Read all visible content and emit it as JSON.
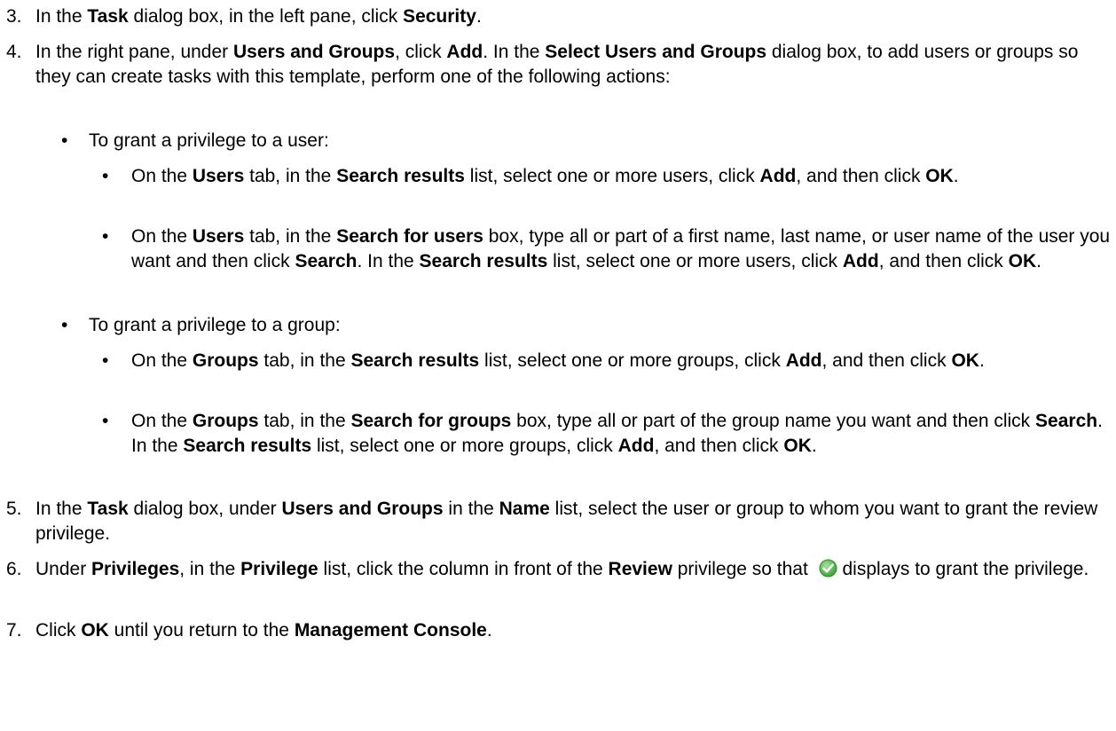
{
  "steps": [
    {
      "num": "3.",
      "parts": [
        {
          "t": "In the "
        },
        {
          "b": "Task"
        },
        {
          "t": " dialog box, in the left pane, click "
        },
        {
          "b": "Security"
        },
        {
          "t": "."
        }
      ]
    },
    {
      "num": "4.",
      "parts": [
        {
          "t": "In the right pane, under "
        },
        {
          "b": "Users and Groups"
        },
        {
          "t": ", click "
        },
        {
          "b": "Add"
        },
        {
          "t": ". In the "
        },
        {
          "b": "Select Users and Groups"
        },
        {
          "t": " dialog box, to add users or groups so they can create tasks with this template, perform one of the following actions:"
        }
      ]
    },
    {
      "num": "5.",
      "parts": [
        {
          "t": "In the "
        },
        {
          "b": "Task"
        },
        {
          "t": " dialog box, under "
        },
        {
          "b": "Users and Groups"
        },
        {
          "t": " in the "
        },
        {
          "b": "Name"
        },
        {
          "t": " list, select the user or group to whom you want to grant the review privilege."
        }
      ]
    },
    {
      "num": "6.",
      "parts": [
        {
          "t": "Under "
        },
        {
          "b": "Privileges"
        },
        {
          "t": ", in the "
        },
        {
          "b": "Privilege"
        },
        {
          "t": " list, click the column in front of the "
        },
        {
          "b": "Review"
        },
        {
          "t": " privilege so that "
        },
        {
          "icon": "checkmark-icon"
        },
        {
          "t": " displays to grant the privilege."
        }
      ]
    },
    {
      "num": "7.",
      "parts": [
        {
          "t": "Click "
        },
        {
          "b": "OK"
        },
        {
          "t": " until you return to the "
        },
        {
          "b": "Management Console"
        },
        {
          "t": "."
        }
      ]
    }
  ],
  "bullets_level1": [
    "To grant a privilege to a user:",
    "To grant a privilege to a group:"
  ],
  "bullets_level2": [
    [
      {
        "t": "On the "
      },
      {
        "b": "Users"
      },
      {
        "t": " tab, in the "
      },
      {
        "b": "Search results"
      },
      {
        "t": " list, select one or more users, click "
      },
      {
        "b": "Add"
      },
      {
        "t": ", and then click "
      },
      {
        "b": "OK"
      },
      {
        "t": "."
      }
    ],
    [
      {
        "t": "On the "
      },
      {
        "b": "Users"
      },
      {
        "t": " tab, in the "
      },
      {
        "b": "Search for users"
      },
      {
        "t": " box, type all or part of a first name, last name, or user name of the user you want and then click "
      },
      {
        "b": "Search"
      },
      {
        "t": ". In the "
      },
      {
        "b": "Search results"
      },
      {
        "t": " list, select one or more users, click "
      },
      {
        "b": "Add"
      },
      {
        "t": ", and then click "
      },
      {
        "b": "OK"
      },
      {
        "t": "."
      }
    ],
    [
      {
        "t": "On the "
      },
      {
        "b": "Groups"
      },
      {
        "t": " tab, in the "
      },
      {
        "b": "Search results"
      },
      {
        "t": " list, select one or more groups, click "
      },
      {
        "b": "Add"
      },
      {
        "t": ", and then click "
      },
      {
        "b": "OK"
      },
      {
        "t": "."
      }
    ],
    [
      {
        "t": "On the "
      },
      {
        "b": "Groups"
      },
      {
        "t": " tab, in the "
      },
      {
        "b": "Search for groups"
      },
      {
        "t": " box, type all or part of the group name you want and then click "
      },
      {
        "b": "Search"
      },
      {
        "t": ". In the "
      },
      {
        "b": "Search results"
      },
      {
        "t": " list, select one or more groups, click "
      },
      {
        "b": "Add"
      },
      {
        "t": ", and then click "
      },
      {
        "b": "OK"
      },
      {
        "t": "."
      }
    ]
  ],
  "bullet_glyph": "•",
  "colors": {
    "text": "#000000",
    "background": "#ffffff",
    "check_green": "#3aa635"
  }
}
